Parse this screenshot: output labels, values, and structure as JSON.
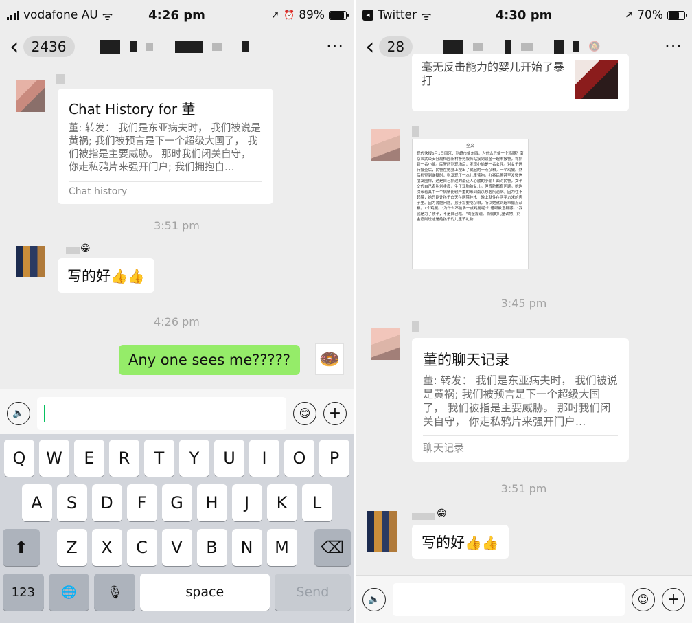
{
  "left": {
    "status": {
      "carrier": "vodafone AU",
      "time": "4:26 pm",
      "battery": "89%",
      "battery_level": 0.89
    },
    "nav": {
      "back_count": "2436",
      "more": "···"
    },
    "messages": {
      "card": {
        "title": "Chat History for 董",
        "body": "董: 转发： 我们是东亚病夫时， 我们被说是黄祸; 我们被预言是下一个超级大国了， 我们被指是主要威胁。 那时我们闭关自守， 你走私鸦片来强开门户; 我们拥抱自…",
        "footer": "Chat history"
      },
      "time1": "3:51 pm",
      "msg1": "写的好",
      "time2": "4:26 pm",
      "msg2": "Any one sees me?????"
    },
    "input": {
      "value": ""
    },
    "keyboard": {
      "row1": [
        "Q",
        "W",
        "E",
        "R",
        "T",
        "Y",
        "U",
        "I",
        "O",
        "P"
      ],
      "row2": [
        "A",
        "S",
        "D",
        "F",
        "G",
        "H",
        "J",
        "K",
        "L"
      ],
      "row3": [
        "Z",
        "X",
        "C",
        "V",
        "B",
        "N",
        "M"
      ],
      "numbers": "123",
      "space": "space",
      "send": "Send"
    }
  },
  "right": {
    "status": {
      "app": "Twitter",
      "time": "4:30 pm",
      "battery": "70%",
      "battery_level": 0.7
    },
    "nav": {
      "back_count": "28",
      "more": "···"
    },
    "messages": {
      "top_card_text": "毫无反击能力的婴儿开始了暴打",
      "screenshot_title": "全文",
      "screenshot_text": "现代快报6月1日南京：到超市偷东西，为什么只偷一个鸡腿？南京玄武公安分局梅园新村警务服务站接到锁金一超市报警，称抓到一名小偷。民警赶到现场后，发现小偷是一名女性。对女子进行搜查后，民警在她身上搜出了藏起的一点杂粮。一个鸡腿。然后检查到嫌疑时，则发现了一本儿童读物。办案民警甚至发微信朋友圈称，这是自己抓过的最让人心酸的小偷！面对民警，女子交代自己名叫刘金霞，生了双胞胎女儿。但肾脏都有问题。她这次带着其中一个病情比较严重的来到南京总医院治病。因为住不起院，她只能让孩子白天在医院挂水，晚上就住在两平方米的房子里。因为肾脏问题，孩子需要吃杂粮，所以她就到超市偷点杂粮。1个鸡腿。\"为什么不偷多一点鸡腿呢\"？谨眼歉意疑惑。\"我就是为了孩子，不是自己吃。\"刘金霞说。而偷的儿童读物，刘金霞则说这是给孩子的儿童节礼物……",
      "time1": "3:45 pm",
      "card": {
        "title": "董的聊天记录",
        "body": "董: 转发： 我们是东亚病夫时， 我们被说是黄祸; 我们被预言是下一个超级大国了， 我们被指是主要威胁。 那时我们闭关自守， 你走私鸦片来强开门户…",
        "footer": "聊天记录"
      },
      "time2": "3:51 pm",
      "msg1": "写的好"
    }
  },
  "icons": {
    "thumbs": "👍👍",
    "smile": "😁",
    "voice": "🔈",
    "emoji": "😊",
    "plus": "+",
    "shift": "⬆",
    "backspace": "⌫",
    "globe": "🌐",
    "mic": "🎙",
    "back_chevron": "‹",
    "wifi": "ᯤ",
    "location": "➚",
    "alarm": "⏰",
    "mute": "🔕",
    "simpsons": "🍩"
  }
}
